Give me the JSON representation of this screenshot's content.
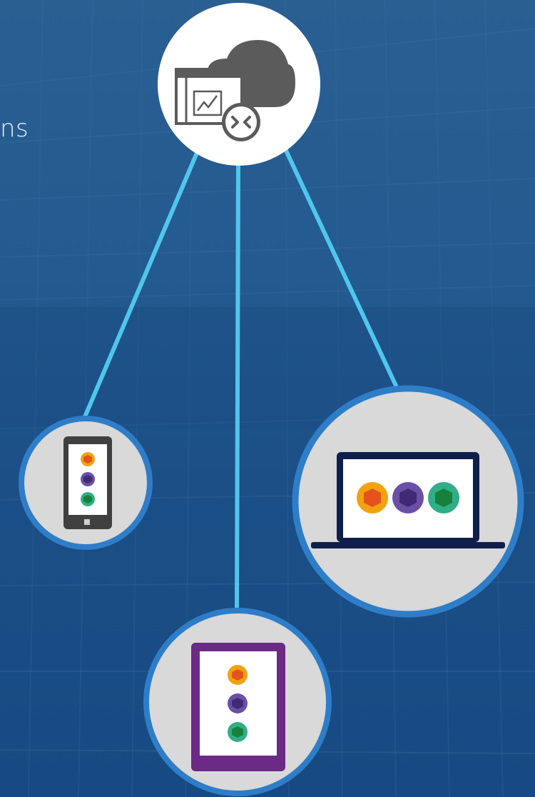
{
  "partial_text": "ns",
  "colors": {
    "background": "#1f548a",
    "connector": "#4fc6ee",
    "node_fill": "#d9d9d9",
    "node_border": "#2e7dc8",
    "server_fill": "#ffffff",
    "icon_gray": "#5b5b5b",
    "phone_frame": "#404040",
    "laptop_frame": "#0f1f4d",
    "tablet_frame": "#6b2a86",
    "cube_orange": "#f2a20f",
    "cube_purple": "#6a4fa6",
    "cube_green": "#2fae87"
  },
  "icons": {
    "server": "cloud-remote-app-icon",
    "phone": "windows-phone-icon",
    "laptop": "laptop-icon",
    "tablet": "tablet-icon",
    "app": "cube-app-icon"
  }
}
